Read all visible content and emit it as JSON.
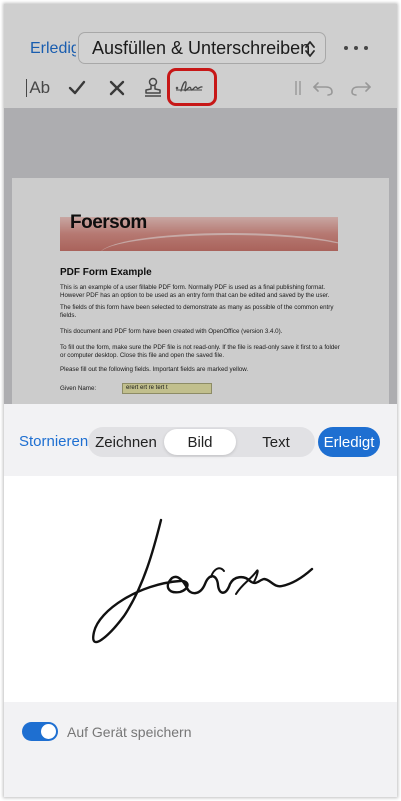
{
  "nav": {
    "done_label": "Erledigt",
    "mode_label": "Ausfüllen & Unterschreiben"
  },
  "toolbar": {
    "text_tool_label": "Ab",
    "icons": [
      "text-tool-icon",
      "checkmark-icon",
      "cross-icon",
      "stamp-icon",
      "signature-icon",
      "undo-icon",
      "redo-icon"
    ]
  },
  "document": {
    "logo_text": "Foersom",
    "title": "PDF Form Example",
    "paragraphs": [
      "This is an example of a user fillable PDF form. Normally PDF is used as a final publishing format. However PDF has an option to be used as an entry form that can be edited and saved by the user.",
      "The fields of this form have been selected to demonstrate as many as possible of the common entry fields.",
      "This document and PDF form have been created with OpenOffice (version 3.4.0).",
      "To fill out the form, make sure the PDF file is not read-only. If the file is read-only save it first to a folder or computer desktop. Close this file and open the saved file.",
      "Please fill out the following fields. Important fields are marked yellow."
    ],
    "field_label": "Given Name:",
    "field_value": "erert ert re tert t"
  },
  "sheet": {
    "cancel_label": "Stornieren",
    "segments": [
      "Zeichnen",
      "Bild",
      "Text"
    ],
    "selected_segment": "Bild",
    "done_label": "Erledigt"
  },
  "footer": {
    "save_toggle_label": "Auf Gerät speichern",
    "save_toggle_on": true
  },
  "colors": {
    "accent": "#1e6fd1",
    "highlight": "#ee1c1c",
    "field_fill": "#e6e4a8"
  }
}
